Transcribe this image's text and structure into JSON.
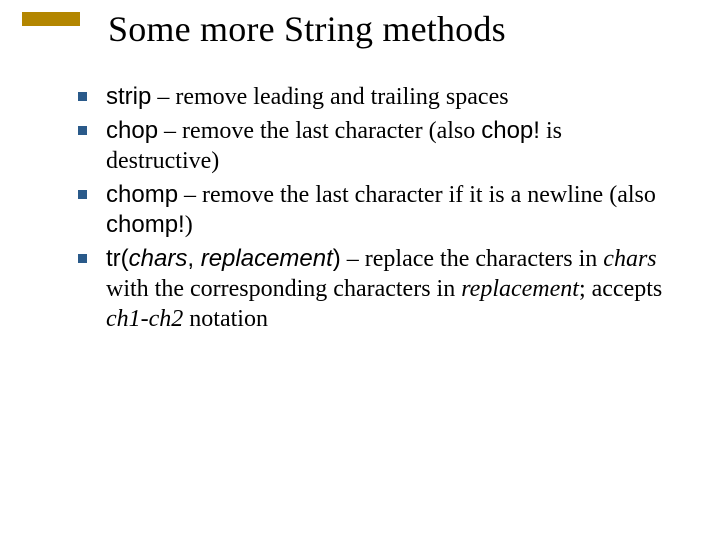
{
  "title": "Some more String methods",
  "bullets": [
    {
      "method": "strip",
      "rest": " – remove leading and trailing spaces"
    },
    {
      "method": "chop",
      "rest1": " – remove the last character (also ",
      "code2": "chop!",
      "rest2": " is destructive)"
    },
    {
      "method": "chomp",
      "rest1": " – remove the last character if it is a newline (also ",
      "code2": "chomp!",
      "rest2": ")"
    },
    {
      "method": "tr",
      "sig_open": "(",
      "arg1": "chars",
      "sep": ", ",
      "arg2": "replacement",
      "sig_close": ")",
      "rest1": " – replace the characters in ",
      "em1": "chars",
      "rest2": " with the corresponding characters in ",
      "em2": "replacement",
      "rest3": "; accepts ",
      "em3": "ch1-ch2",
      "rest4": " notation"
    }
  ]
}
